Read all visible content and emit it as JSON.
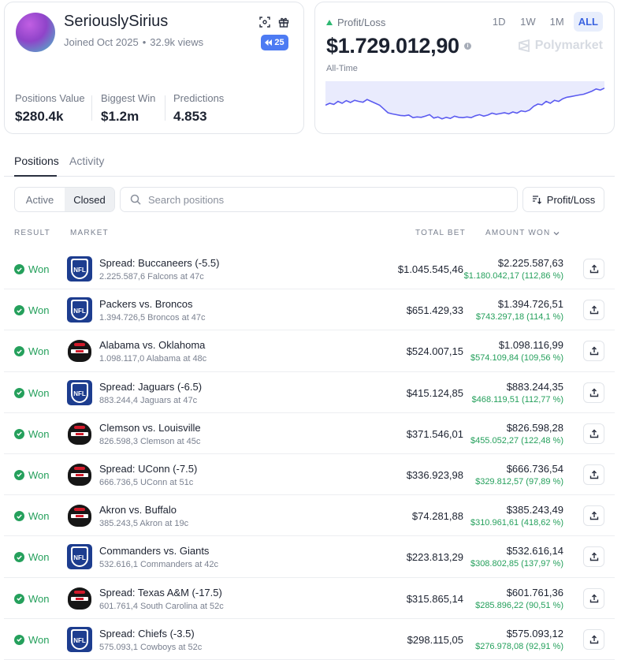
{
  "profile": {
    "username": "SeriouslySirius",
    "joined": "Joined Oct 2025",
    "views": "32.9k views",
    "rank_badge": "25",
    "stats": [
      {
        "label": "Positions Value",
        "value": "$280.4k"
      },
      {
        "label": "Biggest Win",
        "value": "$1.2m"
      },
      {
        "label": "Predictions",
        "value": "4.853"
      }
    ]
  },
  "pnl": {
    "label": "Profit/Loss",
    "value": "$1.729.012,90",
    "period": "All-Time",
    "brand": "Polymarket",
    "ranges": [
      "1D",
      "1W",
      "1M",
      "ALL"
    ],
    "active_range": "ALL",
    "colors": {
      "line": "#5b5bf0",
      "fill": "#e9ebfd",
      "up": "#2eb872"
    }
  },
  "chart_data": {
    "type": "area",
    "series": [
      {
        "values": [
          0.45,
          0.5,
          0.47,
          0.55,
          0.5,
          0.57,
          0.52,
          0.58,
          0.55,
          0.53,
          0.6,
          0.55,
          0.5,
          0.45,
          0.35,
          0.25,
          0.22,
          0.2,
          0.18,
          0.17,
          0.19,
          0.12,
          0.14,
          0.13,
          0.16,
          0.2,
          0.11,
          0.14,
          0.09,
          0.13,
          0.1,
          0.16,
          0.13,
          0.12,
          0.14,
          0.12,
          0.17,
          0.2,
          0.16,
          0.19,
          0.24,
          0.21,
          0.23,
          0.25,
          0.22,
          0.27,
          0.24,
          0.3,
          0.28,
          0.32,
          0.42,
          0.48,
          0.46,
          0.55,
          0.5,
          0.58,
          0.55,
          0.62,
          0.66,
          0.68,
          0.7,
          0.72,
          0.74,
          0.78,
          0.82,
          0.88,
          0.85,
          0.9
        ]
      }
    ],
    "grid": false,
    "legend": false
  },
  "tabs": {
    "positions": "Positions",
    "activity": "Activity"
  },
  "filters": {
    "active": "Active",
    "closed": "Closed",
    "search_placeholder": "Search positions",
    "sort_label": "Profit/Loss"
  },
  "table": {
    "headers": {
      "result": "Result",
      "market": "Market",
      "total_bet": "Total Bet",
      "amount_won": "Amount Won"
    },
    "rows": [
      {
        "result": "Won",
        "league": "nfl",
        "title": "Spread: Buccaneers (-5.5)",
        "subtitle": "2.225.587,6 Falcons at 47c",
        "total_bet": "$1.045.545,46",
        "amount": "$2.225.587,63",
        "gain": "$1.180.042,17 (112,86 %)"
      },
      {
        "result": "Won",
        "league": "nfl",
        "title": "Packers vs. Broncos",
        "subtitle": "1.394.726,5 Broncos at 47c",
        "total_bet": "$651.429,33",
        "amount": "$1.394.726,51",
        "gain": "$743.297,18 (114,1 %)"
      },
      {
        "result": "Won",
        "league": "cfb",
        "title": "Alabama vs. Oklahoma",
        "subtitle": "1.098.117,0 Alabama at 48c",
        "total_bet": "$524.007,15",
        "amount": "$1.098.116,99",
        "gain": "$574.109,84 (109,56 %)"
      },
      {
        "result": "Won",
        "league": "nfl",
        "title": "Spread: Jaguars (-6.5)",
        "subtitle": "883.244,4 Jaguars at 47c",
        "total_bet": "$415.124,85",
        "amount": "$883.244,35",
        "gain": "$468.119,51 (112,77 %)"
      },
      {
        "result": "Won",
        "league": "cfb",
        "title": "Clemson vs. Louisville",
        "subtitle": "826.598,3 Clemson at 45c",
        "total_bet": "$371.546,01",
        "amount": "$826.598,28",
        "gain": "$455.052,27 (122,48 %)"
      },
      {
        "result": "Won",
        "league": "cfb",
        "title": "Spread: UConn (-7.5)",
        "subtitle": "666.736,5 UConn at 51c",
        "total_bet": "$336.923,98",
        "amount": "$666.736,54",
        "gain": "$329.812,57 (97,89 %)"
      },
      {
        "result": "Won",
        "league": "cfb",
        "title": "Akron vs. Buffalo",
        "subtitle": "385.243,5 Akron at 19c",
        "total_bet": "$74.281,88",
        "amount": "$385.243,49",
        "gain": "$310.961,61 (418,62 %)"
      },
      {
        "result": "Won",
        "league": "nfl",
        "title": "Commanders vs. Giants",
        "subtitle": "532.616,1 Commanders at 42c",
        "total_bet": "$223.813,29",
        "amount": "$532.616,14",
        "gain": "$308.802,85 (137,97 %)"
      },
      {
        "result": "Won",
        "league": "cfb",
        "title": "Spread: Texas A&M (-17.5)",
        "subtitle": "601.761,4 South Carolina at 52c",
        "total_bet": "$315.865,14",
        "amount": "$601.761,36",
        "gain": "$285.896,22 (90,51 %)"
      },
      {
        "result": "Won",
        "league": "nfl",
        "title": "Spread: Chiefs (-3.5)",
        "subtitle": "575.093,1 Cowboys at 52c",
        "total_bet": "$298.115,05",
        "amount": "$575.093,12",
        "gain": "$276.978,08 (92,91 %)"
      }
    ]
  },
  "logo_text": {
    "nfl": "NFL"
  }
}
